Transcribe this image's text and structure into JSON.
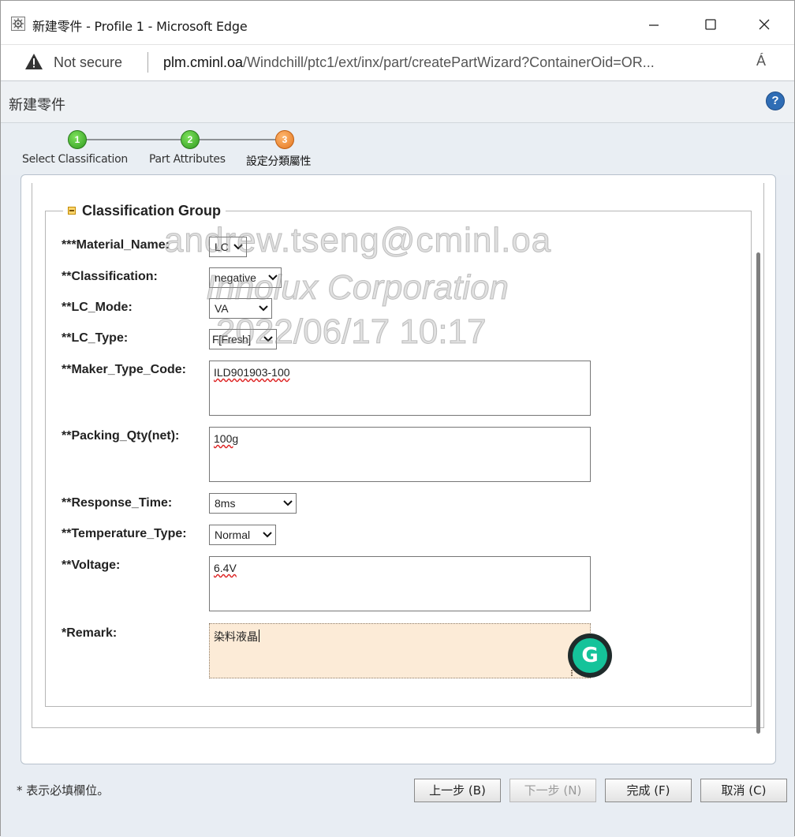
{
  "browser": {
    "title": "新建零件 - Profile 1 - Microsoft Edge",
    "controls": {
      "minimize": "minimize",
      "maximize": "maximize",
      "close": "close"
    },
    "security_label": "Not secure",
    "url_host": "plm.cminl.oa",
    "url_path": "/Windchill/ptc1/ext/inx/part/createPartWizard?ContainerOid=OR...",
    "read_aloud": "Á"
  },
  "page": {
    "title": "新建零件",
    "help": "?"
  },
  "wizard": {
    "steps": [
      {
        "number": "1",
        "label": "Select Classification",
        "state": "done"
      },
      {
        "number": "2",
        "label": "Part Attributes",
        "state": "done"
      },
      {
        "number": "3",
        "label": "設定分類屬性",
        "state": "current"
      }
    ]
  },
  "group": {
    "title": "Classification Group"
  },
  "fields": {
    "material_name": {
      "label": "***Material_Name:",
      "value": "LC"
    },
    "classification": {
      "label": "**Classification:",
      "value": "negative"
    },
    "lc_mode": {
      "label": "**LC_Mode:",
      "value": "VA"
    },
    "lc_type": {
      "label": "**LC_Type:",
      "value": "F[Fresh]"
    },
    "maker_type_code": {
      "label": "**Maker_Type_Code:",
      "value": "ILD901903-100"
    },
    "packing_qty": {
      "label": "**Packing_Qty(net):",
      "value": "100g"
    },
    "response_time": {
      "label": "**Response_Time:",
      "value": "8ms"
    },
    "temperature_type": {
      "label": "**Temperature_Type:",
      "value": "Normal"
    },
    "voltage": {
      "label": "**Voltage:",
      "value": "6.4V"
    },
    "remark": {
      "label": "*Remark:",
      "value": "染料液晶"
    }
  },
  "watermark": {
    "line1": "andrew.tseng@cminl.oa",
    "line2": "Innolux Corporation",
    "line3": "2022/06/17 10:17"
  },
  "footer": {
    "required_note": "* 表示必填欄位。",
    "prev_label": "上一步 (B)",
    "next_label": "下一步 (N)",
    "finish_label": "完成 (F)",
    "cancel_label": "取消 (C)"
  },
  "colors": {
    "step_done": "#3fae2a",
    "step_current": "#f08a2c",
    "remark_bg": "#fcebd7",
    "grammarly": "#15c39a"
  }
}
